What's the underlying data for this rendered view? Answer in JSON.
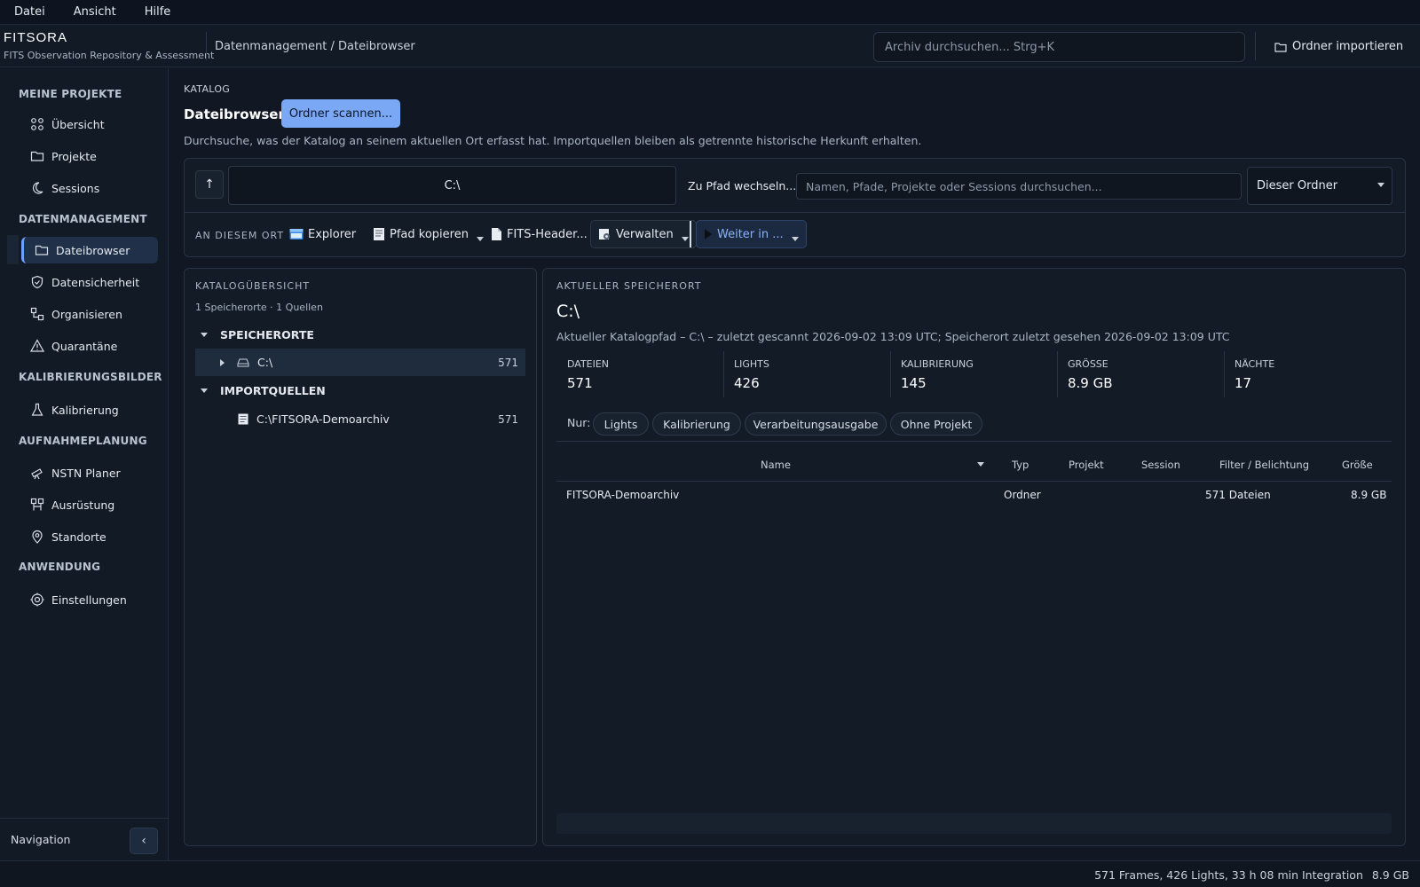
{
  "menubar": {
    "items": [
      "Datei",
      "Ansicht",
      "Hilfe"
    ]
  },
  "header": {
    "app_name": "FITSORA",
    "app_subtitle": "FITS Observation Repository & Assessment",
    "breadcrumb": "Datenmanagement / Dateibrowser",
    "search_placeholder": "Archiv durchsuchen...  Strg+K",
    "import_label": "Ordner importieren"
  },
  "sidebar": {
    "sections": [
      "MEINE PROJEKTE",
      "DATENMANAGEMENT",
      "KALIBRIERUNGSBILDER",
      "AUFNAHMEPLANUNG",
      "ANWENDUNG"
    ],
    "items": [
      {
        "label": "Übersicht",
        "icon": "grid-icon"
      },
      {
        "label": "Projekte",
        "icon": "folder-icon"
      },
      {
        "label": "Sessions",
        "icon": "moon-icon"
      },
      {
        "label": "Dateibrowser",
        "icon": "folder-icon",
        "active": true
      },
      {
        "label": "Datensicherheit",
        "icon": "shield-icon"
      },
      {
        "label": "Organisieren",
        "icon": "organize-icon"
      },
      {
        "label": "Quarantäne",
        "icon": "warning-icon"
      },
      {
        "label": "Kalibrierung",
        "icon": "flask-icon"
      },
      {
        "label": "NSTN Planer",
        "icon": "telescope-icon"
      },
      {
        "label": "Ausrüstung",
        "icon": "equipment-icon"
      },
      {
        "label": "Standorte",
        "icon": "pin-icon"
      },
      {
        "label": "Einstellungen",
        "icon": "gear-icon"
      }
    ],
    "footer_label": "Navigation",
    "collapse_glyph": "‹"
  },
  "main": {
    "section_label": "KATALOG",
    "title": "Dateibrowser",
    "scan_button": "Ordner scannen...",
    "description": "Durchsuche, was der Katalog an seinem aktuellen Ort erfasst hat. Importquellen bleiben als getrennte historische Herkunft erhalten.",
    "up_glyph": "↑",
    "path_value": "C:\\",
    "goto_label": "Zu Pfad wechseln...",
    "filter_placeholder": "Namen, Pfade, Projekte oder Sessions durchsuchen...",
    "scope_value": "Dieser Ordner",
    "here_label": "AN DIESEM ORT",
    "actions": {
      "explorer": "Explorer",
      "copy_path": "Pfad kopieren",
      "fits_header": "FITS-Header...",
      "manage": "Verwalten",
      "continue_in": "Weiter in ..."
    }
  },
  "catalog_overview": {
    "title": "KATALOGÜBERSICHT",
    "summary": "1 Speicherorte · 1 Quellen",
    "locations_header": "SPEICHERORTE",
    "locations": [
      {
        "name": "C:\\",
        "count": "571"
      }
    ],
    "sources_header": "IMPORTQUELLEN",
    "sources": [
      {
        "name": "C:\\FITSORA-Demoarchiv",
        "count": "571"
      }
    ]
  },
  "current_location": {
    "title": "AKTUELLER SPEICHERORT",
    "path": "C:\\",
    "description": "Aktueller Katalogpfad – C:\\ – zuletzt gescannt 2026-09-02 13:09 UTC; Speicherort zuletzt gesehen 2026-09-02 13:09 UTC",
    "stats": [
      {
        "label": "DATEIEN",
        "value": "571"
      },
      {
        "label": "LIGHTS",
        "value": "426"
      },
      {
        "label": "KALIBRIERUNG",
        "value": "145"
      },
      {
        "label": "GRÖSSE",
        "value": "8.9 GB"
      },
      {
        "label": "NÄCHTE",
        "value": "17"
      }
    ],
    "filter_prefix": "Nur:",
    "chips": [
      "Lights",
      "Kalibrierung",
      "Verarbeitungsausgabe",
      "Ohne Projekt"
    ],
    "table": {
      "columns": [
        "Name",
        "Typ",
        "Projekt",
        "Session",
        "Filter / Belichtung",
        "Größe"
      ],
      "rows": [
        {
          "name": "FITSORA-Demoarchiv",
          "type": "Ordner",
          "project": "",
          "session": "",
          "filter": "571 Dateien",
          "size": "8.9 GB"
        }
      ]
    }
  },
  "statusbar": {
    "summary": "571 Frames, 426 Lights, 33 h 08 min Integration",
    "size": "8.9 GB"
  },
  "colors": {
    "accent": "#7aa8f5",
    "background": "#111824",
    "panel": "#131b27",
    "active_nav": "#203048"
  }
}
